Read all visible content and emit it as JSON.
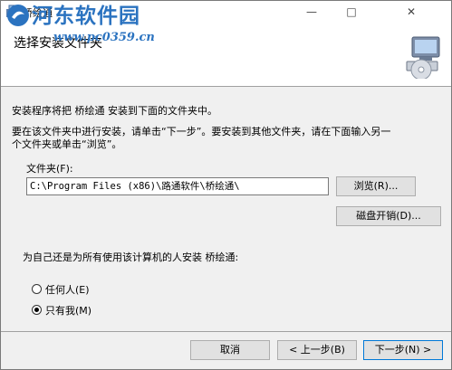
{
  "window": {
    "title": "桥绘通",
    "minimize_icon": "—",
    "maximize_icon": "□",
    "close_icon": "✕"
  },
  "watermark": {
    "site_name": "河东软件园",
    "url": "www.pc0359.cn"
  },
  "header": {
    "title": "选择安装文件夹"
  },
  "body": {
    "intro": "安装程序将把 桥绘通 安装到下面的文件夹中。",
    "instructions_line1": "要在该文件夹中进行安装，请单击“下一步”。要安装到其他文件夹，请在下面输入另一",
    "instructions_line2": "个文件夹或单击“浏览”。",
    "folder_label": "文件夹(F):",
    "folder_value": "C:\\Program Files (x86)\\路通软件\\桥绘通\\",
    "browse_label": "浏览(R)...",
    "disk_cost_label": "磁盘开销(D)...",
    "users_question": "为自己还是为所有使用该计算机的人安装 桥绘通:",
    "options": [
      {
        "label": "任何人(E)",
        "selected": false
      },
      {
        "label": "只有我(M)",
        "selected": true
      }
    ]
  },
  "footer": {
    "cancel_label": "取消",
    "back_label": "< 上一步(B)",
    "next_label": "下一步(N) >"
  }
}
